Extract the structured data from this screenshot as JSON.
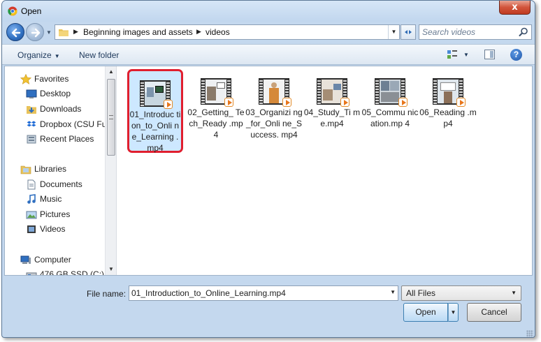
{
  "window": {
    "title": "Open",
    "close_label": "x"
  },
  "address": {
    "breadcrumbs": [
      "Beginning images and assets",
      "videos"
    ],
    "search_placeholder": "Search videos"
  },
  "toolbar": {
    "organize_label": "Organize",
    "new_folder_label": "New folder",
    "help_label": "?"
  },
  "sidebar": {
    "favorites": {
      "label": "Favorites",
      "items": [
        {
          "label": "Desktop",
          "icon": "desktop-icon"
        },
        {
          "label": "Downloads",
          "icon": "downloads-icon"
        },
        {
          "label": "Dropbox (CSU Fu",
          "icon": "dropbox-icon"
        },
        {
          "label": "Recent Places",
          "icon": "recent-places-icon"
        }
      ]
    },
    "libraries": {
      "label": "Libraries",
      "items": [
        {
          "label": "Documents",
          "icon": "documents-icon"
        },
        {
          "label": "Music",
          "icon": "music-icon"
        },
        {
          "label": "Pictures",
          "icon": "pictures-icon"
        },
        {
          "label": "Videos",
          "icon": "videos-icon"
        }
      ]
    },
    "computer": {
      "label": "Computer",
      "items": [
        {
          "label": "476 GB SSD (C:)",
          "icon": "drive-icon"
        }
      ]
    }
  },
  "files": [
    {
      "name": "01_Introduction_to_Online_Learning.mp4",
      "display": "01_Introduc tion_to_Onli ne_Learning .mp4",
      "selected": true
    },
    {
      "name": "02_Getting_Tech_Ready.mp4",
      "display": "02_Getting_ Tech_Ready .mp4",
      "selected": false
    },
    {
      "name": "03_Organizing_for_Online_Success.mp4",
      "display": "03_Organizi ng_for_Onli ne_Success. mp4",
      "selected": false
    },
    {
      "name": "04_Study_Time.mp4",
      "display": "04_Study_Ti me.mp4",
      "selected": false
    },
    {
      "name": "05_Communication.mp4",
      "display": "05_Commu nication.mp 4",
      "selected": false
    },
    {
      "name": "06_Reading.mp4",
      "display": "06_Reading .mp4",
      "selected": false
    }
  ],
  "footer": {
    "file_name_label": "File name:",
    "file_name_value": "01_Introduction_to_Online_Learning.mp4",
    "filter_value": "All Files",
    "open_label": "Open",
    "cancel_label": "Cancel"
  },
  "colors": {
    "selection_outline": "#e01f2f",
    "selection_fill": "#cde8ff",
    "window_frame": "#c4d8ee"
  }
}
